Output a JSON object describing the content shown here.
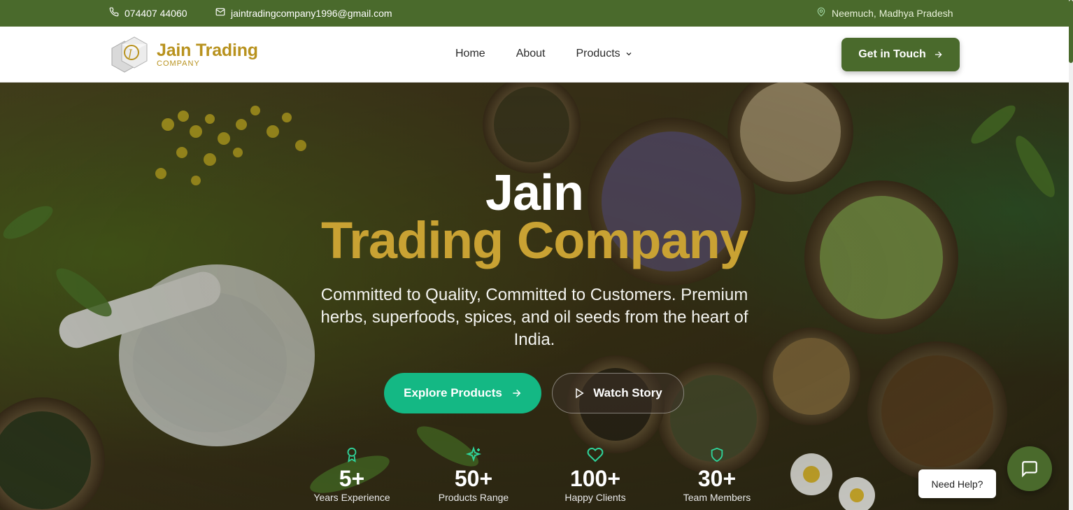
{
  "topbar": {
    "phone": "074407 44060",
    "email": "jaintradingcompany1996@gmail.com",
    "location": "Neemuch, Madhya Pradesh"
  },
  "brand": {
    "name": "Jain Trading",
    "sub": "COMPANY",
    "accent": "#b8921e"
  },
  "nav": {
    "items": [
      {
        "label": "Home"
      },
      {
        "label": "About"
      },
      {
        "label": "Products"
      }
    ],
    "cta_label": "Get in Touch"
  },
  "hero": {
    "title_line1": "Jain",
    "title_line2": "Trading Company",
    "tagline": "Committed to Quality, Committed to Customers. Premium herbs, superfoods, spices, and oil seeds from the heart of India.",
    "primary_button": "Explore Products",
    "secondary_button": "Watch Story"
  },
  "stats": [
    {
      "icon": "award-icon",
      "value": "5+",
      "label": "Years Experience"
    },
    {
      "icon": "sparkles-icon",
      "value": "50+",
      "label": "Products Range"
    },
    {
      "icon": "heart-icon",
      "value": "100+",
      "label": "Happy Clients"
    },
    {
      "icon": "shield-icon",
      "value": "30+",
      "label": "Team Members"
    }
  ],
  "help": {
    "label": "Need Help?"
  },
  "colors": {
    "primary_green": "#4a6a2c",
    "gold": "#c9a233",
    "emerald_button": "#14b884",
    "stat_icon": "#2fd39a"
  }
}
